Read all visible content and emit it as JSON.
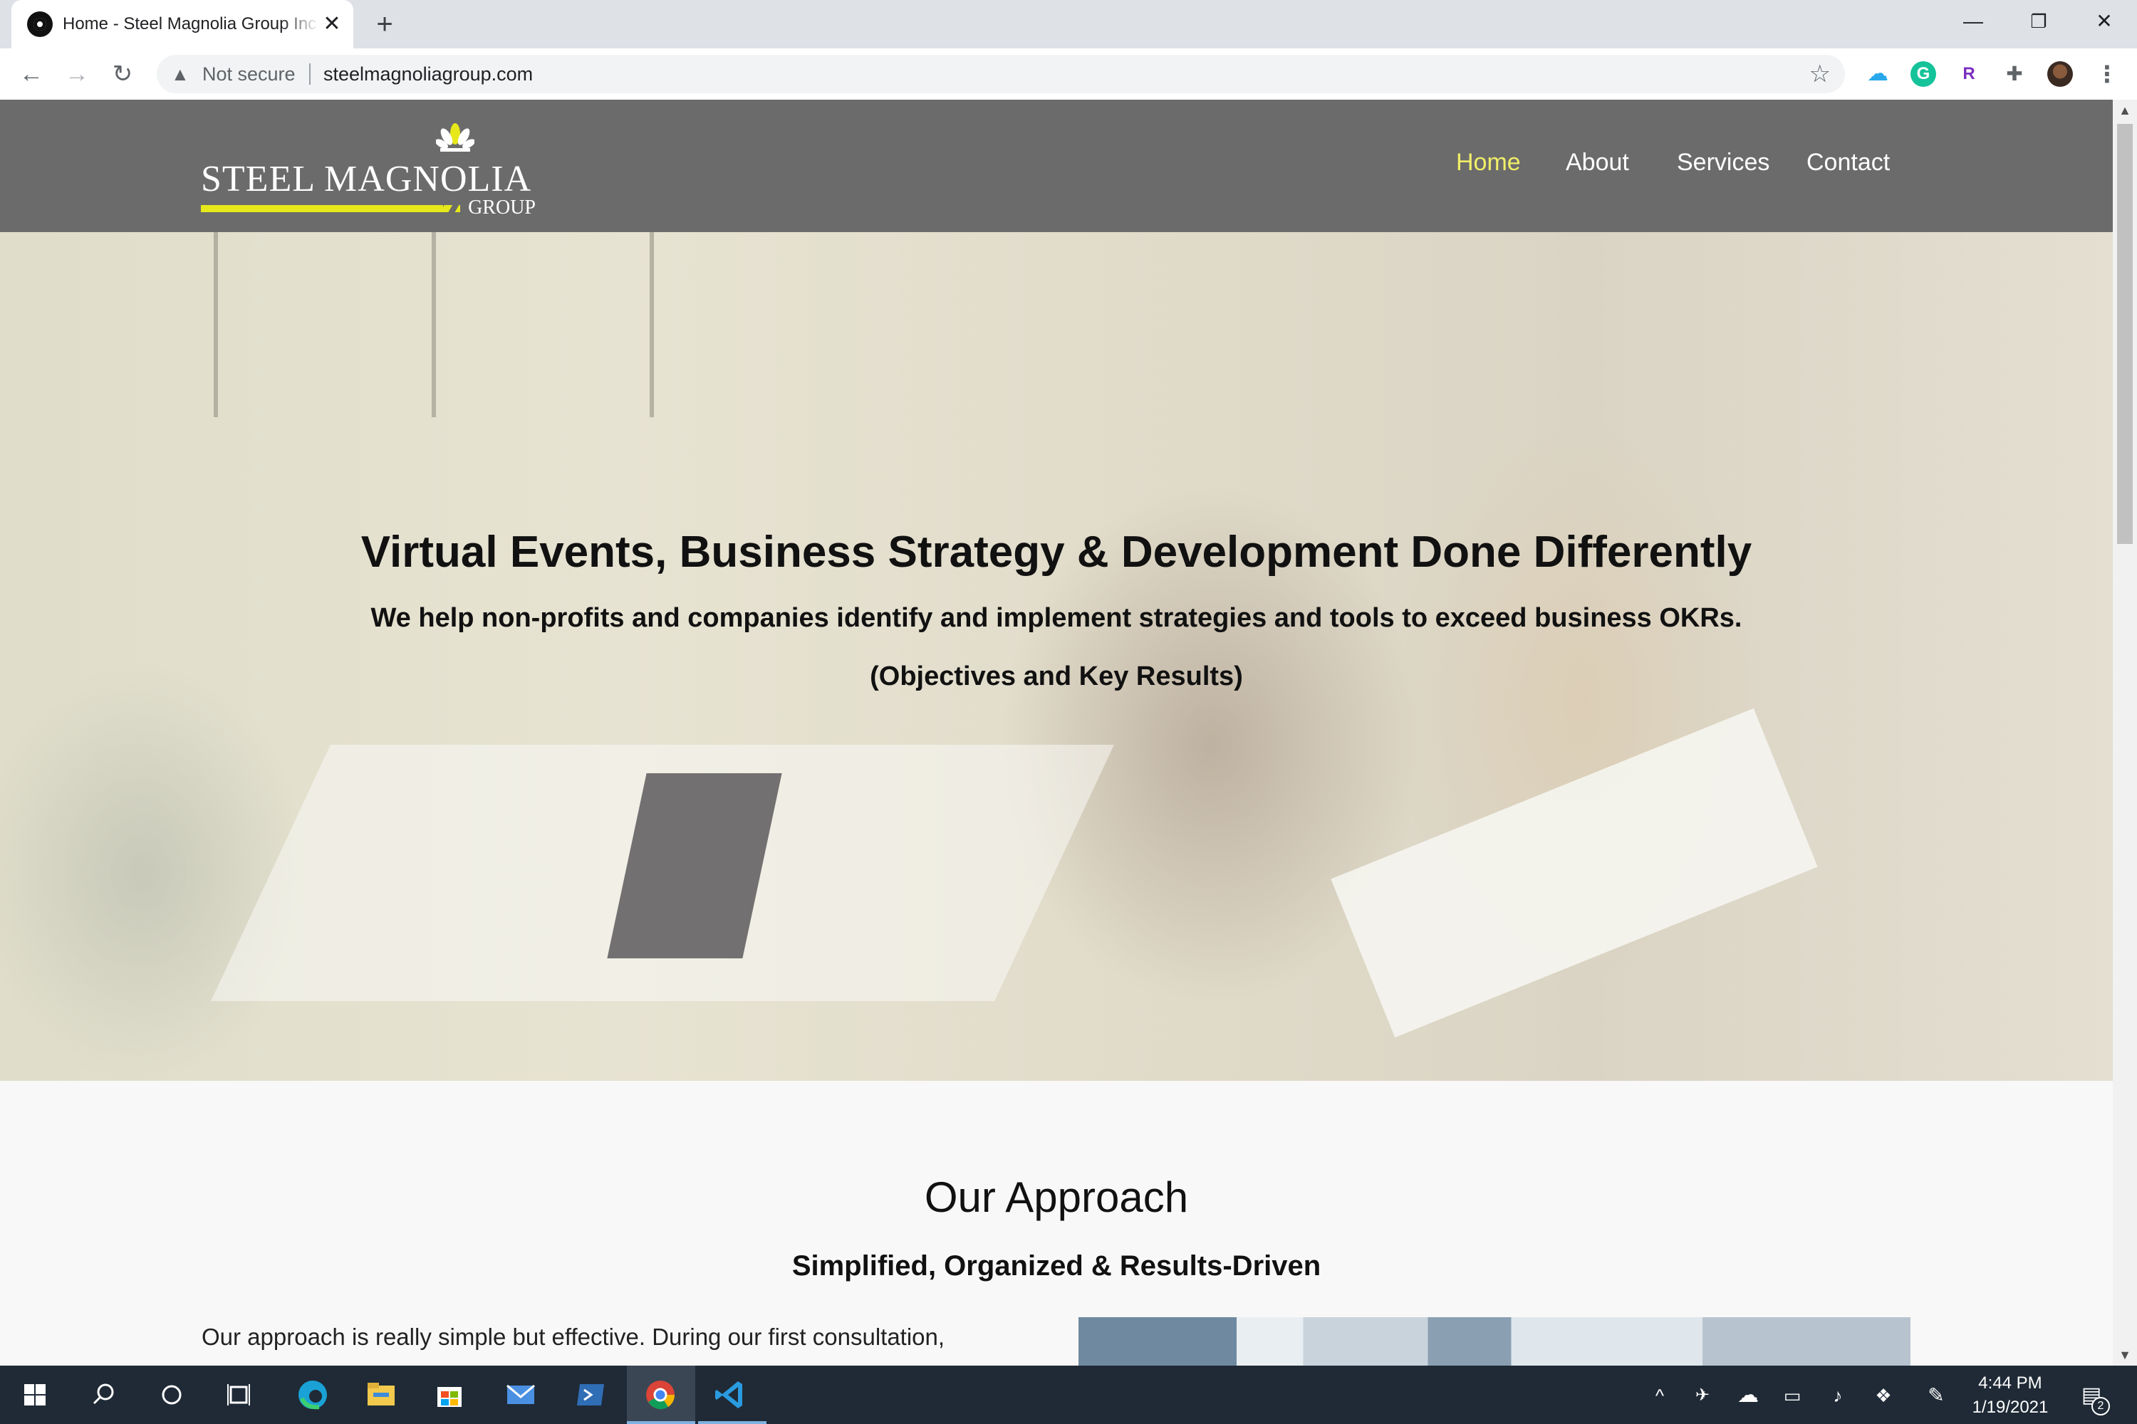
{
  "browser": {
    "tab_title": "Home - Steel Magnolia Group Inc",
    "tab_close": "✕",
    "new_tab": "+",
    "window_controls": {
      "minimize": "—",
      "restore": "❐",
      "close": "✕"
    },
    "nav": {
      "back": "←",
      "forward": "→",
      "reload": "↻"
    },
    "security_label": "Not secure",
    "url": "steelmagnoliagroup.com",
    "warning_glyph": "▲",
    "star_glyph": "☆",
    "extensions": [
      {
        "name": "onedrive-icon",
        "glyph": "☁",
        "color": "#28a8ea"
      },
      {
        "name": "grammarly-icon",
        "glyph": "G",
        "color": "#15c39a"
      },
      {
        "name": "r-extension-icon",
        "glyph": "R",
        "color": "#7b2fbf"
      },
      {
        "name": "puzzle-icon",
        "glyph": "✚",
        "color": "#5f6368"
      }
    ],
    "menu_glyph": "⋮"
  },
  "site": {
    "logo": {
      "name": "STEEL MAGNOLIA",
      "sub": "GROUP"
    },
    "nav": [
      {
        "label": "Home",
        "active": true
      },
      {
        "label": "About",
        "active": false
      },
      {
        "label": "Services",
        "active": false
      },
      {
        "label": "Contact",
        "active": false
      }
    ],
    "hero": {
      "title": "Virtual Events, Business Strategy & Development Done Differently",
      "subtitle": "We help non-profits and companies identify and implement strategies and tools to exceed business OKRs.",
      "subtitle2": "(Objectives and Key Results)"
    },
    "approach": {
      "title": "Our Approach",
      "subtitle": "Simplified, Organized & Results-Driven",
      "text": "Our approach is really simple but effective. During our first consultation,"
    }
  },
  "taskbar": {
    "clock": {
      "time": "4:44 PM",
      "date": "1/19/2021"
    },
    "notification_count": "2",
    "colors": {
      "background": "#1f2a36",
      "accent": "#7fb2e0"
    }
  },
  "colors": {
    "header_bg": "#6b6b6b",
    "nav_active": "#f1ee69",
    "logo_accent": "#e6e81a"
  }
}
